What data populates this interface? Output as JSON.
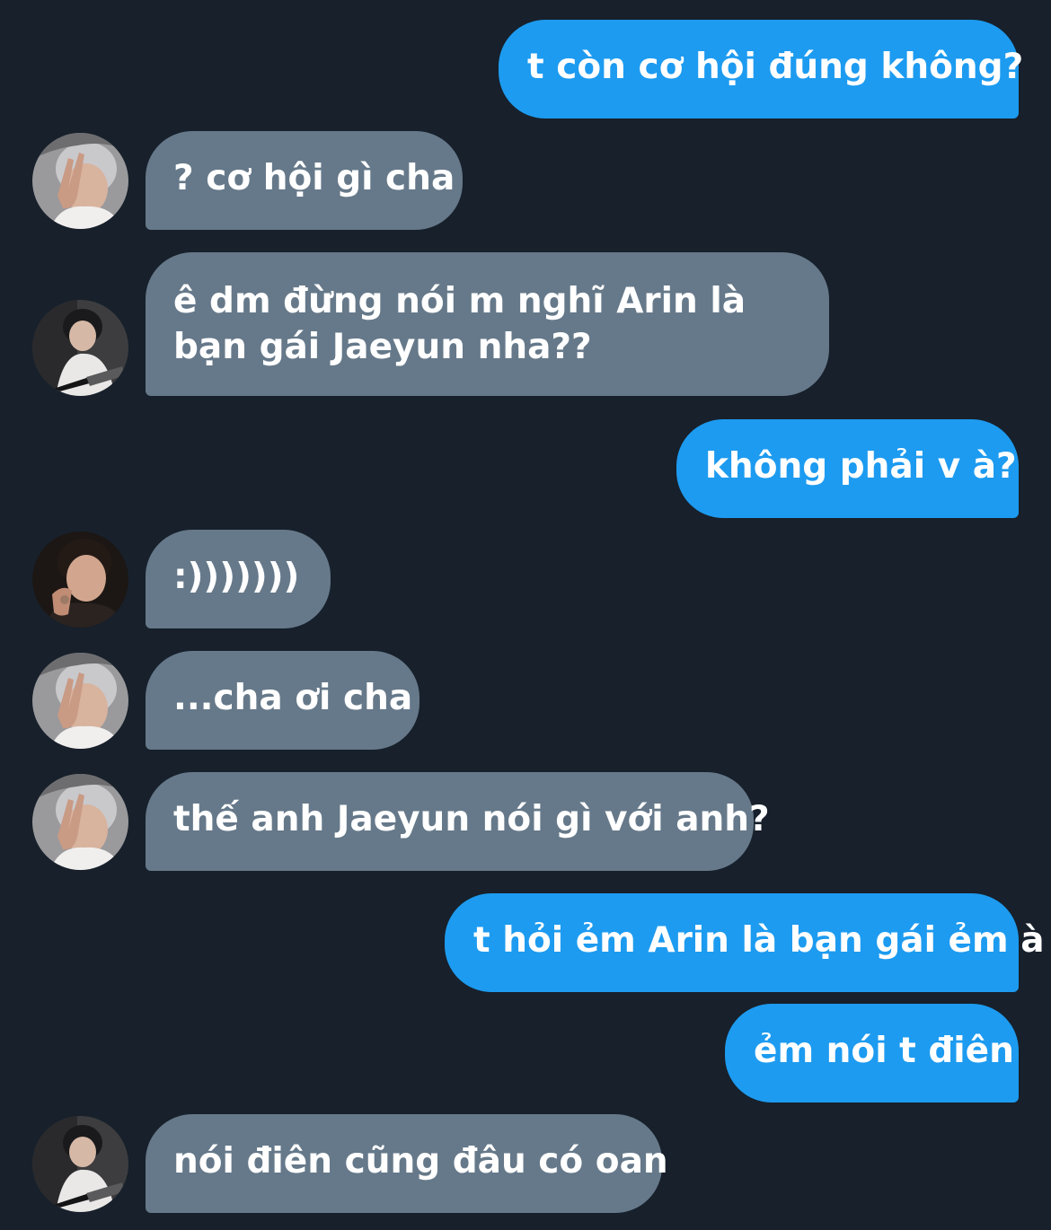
{
  "messages": [
    {
      "sender": "me",
      "text": "t còn cơ hội đúng không?"
    },
    {
      "sender": "other",
      "avatar": "contact-a-avatar",
      "text": "? cơ hội gì cha"
    },
    {
      "sender": "other",
      "avatar": "contact-b-avatar",
      "text": "ê dm đừng nói m nghĩ Arin là bạn gái Jaeyun nha??"
    },
    {
      "sender": "me",
      "text": "không phải v à?"
    },
    {
      "sender": "other",
      "avatar": "contact-c-avatar",
      "text": ":)))))))"
    },
    {
      "sender": "other",
      "avatar": "contact-a-avatar",
      "text": "...cha ơi cha"
    },
    {
      "sender": "other",
      "avatar": "contact-a-avatar",
      "text": "thế anh Jaeyun nói gì với anh?"
    },
    {
      "sender": "me",
      "text": "t hỏi ẻm Arin là bạn gái ẻm à"
    },
    {
      "sender": "me",
      "text": "ẻm nói t điên"
    },
    {
      "sender": "other",
      "avatar": "contact-b-avatar",
      "text": "nói điên cũng đâu có oan"
    }
  ],
  "colors": {
    "background": "#17202b",
    "sent_bubble": "#1d9bf0",
    "received_bubble": "#66798a",
    "text": "#ffffff"
  }
}
